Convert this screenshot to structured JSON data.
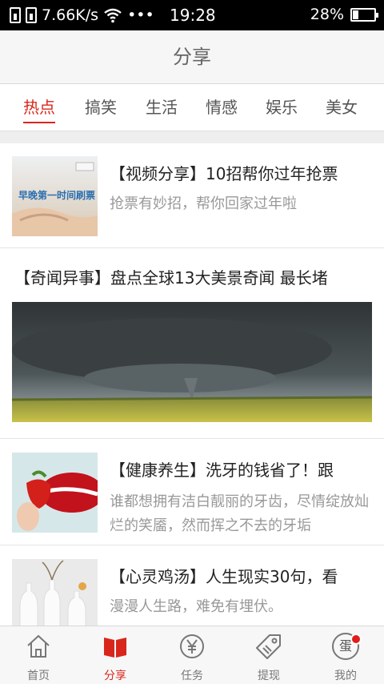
{
  "status_bar": {
    "speed": "7.66K/s",
    "dots": "•••",
    "time": "19:28",
    "battery_percent": "28%",
    "battery_level": 0.28
  },
  "header": {
    "title": "分享"
  },
  "tabs": [
    {
      "label": "热点",
      "active": true
    },
    {
      "label": "搞笑"
    },
    {
      "label": "生活"
    },
    {
      "label": "情感"
    },
    {
      "label": "娱乐"
    },
    {
      "label": "美女"
    }
  ],
  "feed": [
    {
      "title": "【视频分享】10招帮你过年抢票",
      "subtitle": "抢票有妙招，帮你回家过年啦",
      "thumb_text": "早晚第一时间刷票",
      "thumb_icon": "hand-ticket-image"
    },
    {
      "title": "【奇闻异事】盘点全球13大美景奇闻 最长堵",
      "image_icon": "storm-field-image"
    },
    {
      "title": "【健康养生】洗牙的钱省了！跟",
      "subtitle": "谁都想拥有洁白靓丽的牙齿，尽情绽放灿烂的笑靥，然而挥之不去的牙垢",
      "thumb_icon": "strawberry-lips-image"
    },
    {
      "title": "【心灵鸡汤】人生现实30句，看",
      "subtitle": "漫漫人生路，难免有埋伏。",
      "thumb_icon": "vases-image"
    }
  ],
  "bottom_nav": [
    {
      "label": "首页",
      "icon": "home-icon"
    },
    {
      "label": "分享",
      "icon": "book-icon",
      "active": true
    },
    {
      "label": "任务",
      "icon": "yen-coin-icon"
    },
    {
      "label": "提现",
      "icon": "tag-icon"
    },
    {
      "label": "我的",
      "icon": "egg-icon",
      "icon_text": "蛋",
      "badge": true
    }
  ],
  "colors": {
    "accent": "#d9261c",
    "muted": "#999999",
    "title_bar": "#f6f6f6"
  }
}
